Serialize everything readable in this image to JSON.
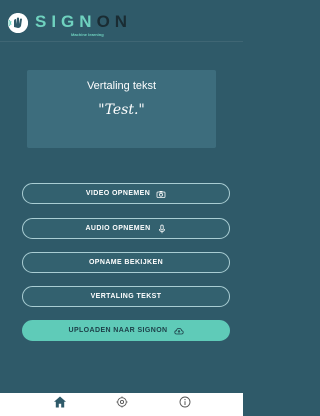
{
  "header": {
    "logo_letters_accent": "SIGN",
    "logo_letters_dark": "ON",
    "logo_subtitle": "Machine learning",
    "logo_icon": "signon-hand-icon"
  },
  "card": {
    "title": "Vertaling tekst",
    "text": "\"Test.\""
  },
  "buttons": [
    {
      "label": "VIDEO OPNEMEN",
      "icon": "camera-icon"
    },
    {
      "label": "AUDIO OPNEMEN",
      "icon": "microphone-icon"
    },
    {
      "label": "OPNAME BEKIJKEN",
      "icon": ""
    },
    {
      "label": "VERTALING TEKST",
      "icon": ""
    },
    {
      "label": "UPLOADEN NAAR SIGNON",
      "icon": "cloud-upload-icon"
    }
  ],
  "bottom_nav": [
    {
      "name": "home",
      "icon": "home-icon",
      "active": true
    },
    {
      "name": "settings",
      "icon": "gear-icon",
      "active": false
    },
    {
      "name": "info",
      "icon": "info-icon",
      "active": false
    }
  ],
  "colors": {
    "background": "#2f5a69",
    "card": "#3d6d7d",
    "accent": "#5fcbb8",
    "button_border": "#a9cdd3",
    "active_nav": "#2f5a69",
    "inactive_nav": "#555555"
  }
}
